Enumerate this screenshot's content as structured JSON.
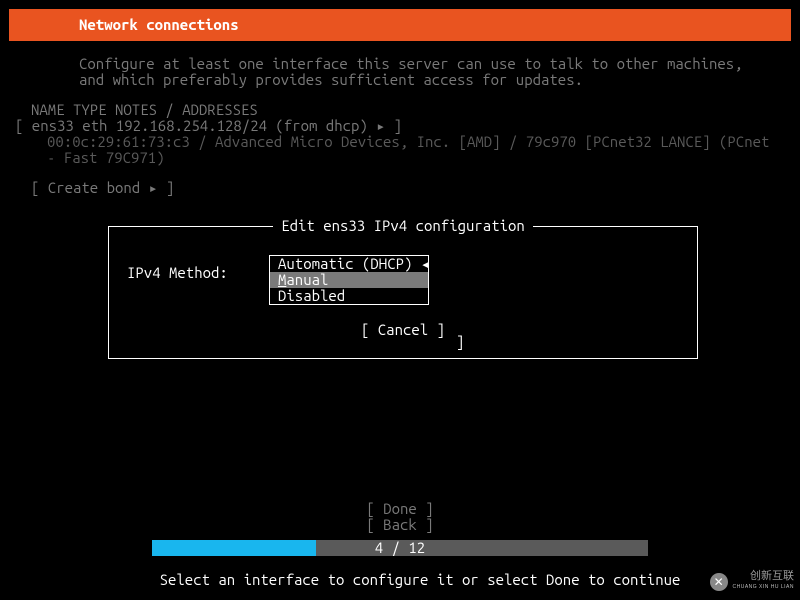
{
  "header": {
    "title": "Network connections"
  },
  "intro": {
    "line1": "Configure at least one interface this server can use to talk to other machines,",
    "line2": "and which preferably provides sufficient access for updates."
  },
  "columns": {
    "header": "NAME  TYPE  NOTES / ADDRESSES"
  },
  "interface": {
    "row": "[ ens33  eth   192.168.254.128/24 (from dhcp)  ▸                                         ]",
    "details1": "00:0c:29:61:73:c3 / Advanced Micro Devices, Inc. [AMD] / 79c970 [PCnet32 LANCE] (PCnet",
    "details2": "- Fast 79C971)"
  },
  "create_bond": {
    "label": "[ Create bond ▸ ]"
  },
  "dialog": {
    "title": "Edit ens33 IPv4 configuration",
    "label": "IPv4 Method:",
    "options": {
      "auto": "Automatic (DHCP) ◂",
      "manual_prefix": "M",
      "manual_rest": "anual",
      "disabled": "Disabled"
    },
    "extra_bracket": "]",
    "cancel": "[ Cancel    ]"
  },
  "bottom": {
    "done": "[ Done       ]",
    "back": "[ Back       ]"
  },
  "progress": {
    "text": "4 / 12",
    "percent": 33
  },
  "help": {
    "text": "Select an interface to configure it or select Done to continue"
  },
  "watermark": {
    "main": "创新互联",
    "sub": "CHUANG XIN HU LIAN"
  }
}
